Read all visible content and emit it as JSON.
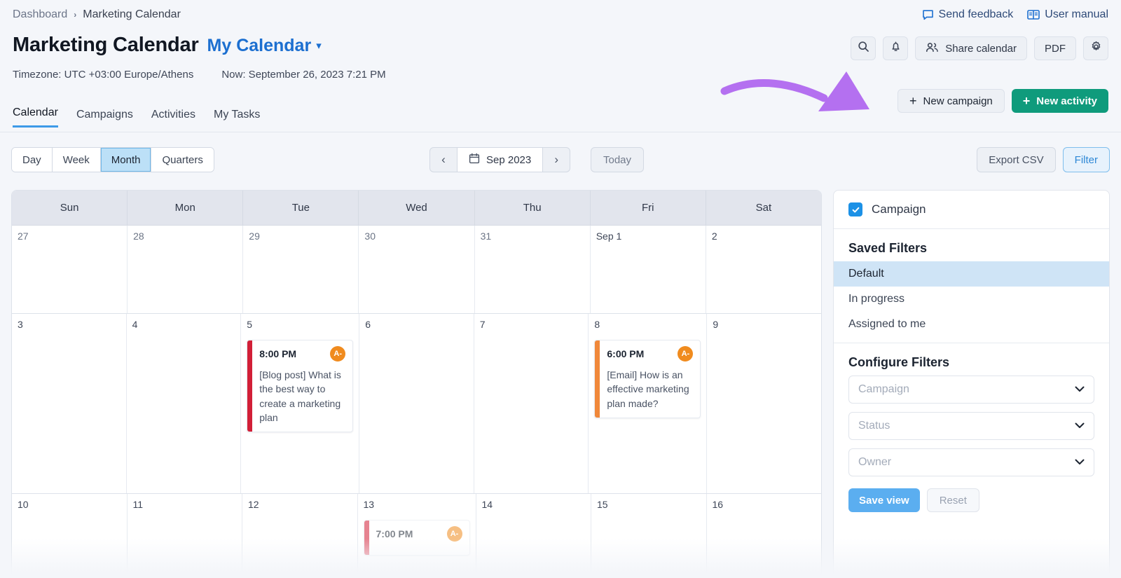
{
  "breadcrumb": {
    "root": "Dashboard",
    "separator": "›",
    "current": "Marketing Calendar"
  },
  "toplinks": {
    "feedback": "Send feedback",
    "manual": "User manual"
  },
  "header": {
    "title": "Marketing Calendar",
    "calendar_name": "My Calendar",
    "timezone": "Timezone: UTC +03:00 Europe/Athens",
    "now": "Now: September 26, 2023 7:21 PM",
    "share_calendar": "Share calendar",
    "pdf": "PDF"
  },
  "tabs": [
    {
      "label": "Calendar",
      "active": true
    },
    {
      "label": "Campaigns",
      "active": false
    },
    {
      "label": "Activities",
      "active": false
    },
    {
      "label": "My Tasks",
      "active": false
    }
  ],
  "actions": {
    "new_campaign": "New campaign",
    "new_activity": "New activity",
    "plus": "+"
  },
  "controls": {
    "views": [
      "Day",
      "Week",
      "Month",
      "Quarters"
    ],
    "active_view": "Month",
    "prev": "‹",
    "next": "›",
    "date_label": "Sep 2023",
    "today": "Today",
    "export": "Export CSV",
    "filter": "Filter"
  },
  "calendar": {
    "weekdays": [
      "Sun",
      "Mon",
      "Tue",
      "Wed",
      "Thu",
      "Fri",
      "Sat"
    ],
    "weeks": [
      {
        "days": [
          {
            "num": "27",
            "in_month": false
          },
          {
            "num": "28",
            "in_month": false
          },
          {
            "num": "29",
            "in_month": false
          },
          {
            "num": "30",
            "in_month": false
          },
          {
            "num": "31",
            "in_month": false
          },
          {
            "num": "Sep 1",
            "in_month": true
          },
          {
            "num": "2",
            "in_month": true
          }
        ]
      },
      {
        "days": [
          {
            "num": "3",
            "in_month": true
          },
          {
            "num": "4",
            "in_month": true
          },
          {
            "num": "5",
            "in_month": true,
            "event": {
              "time": "8:00 PM",
              "title": "[Blog post] What is the best way to create a marketing plan",
              "avatar": "A-",
              "bar_color": "#D21F37"
            }
          },
          {
            "num": "6",
            "in_month": true
          },
          {
            "num": "7",
            "in_month": true
          },
          {
            "num": "8",
            "in_month": true,
            "event": {
              "time": "6:00 PM",
              "title": "[Email] How is an effective marketing plan made?",
              "avatar": "A-",
              "bar_color": "#F0883A"
            }
          },
          {
            "num": "9",
            "in_month": true
          }
        ]
      },
      {
        "days": [
          {
            "num": "10",
            "in_month": true
          },
          {
            "num": "11",
            "in_month": true
          },
          {
            "num": "12",
            "in_month": true
          },
          {
            "num": "13",
            "in_month": true,
            "event": {
              "time": "7:00 PM",
              "title": "",
              "avatar": "A-",
              "bar_color": "#D21F37",
              "faded": true
            }
          },
          {
            "num": "14",
            "in_month": true
          },
          {
            "num": "15",
            "in_month": true
          },
          {
            "num": "16",
            "in_month": true
          }
        ]
      }
    ]
  },
  "filters": {
    "campaign_checkbox": "Campaign",
    "campaign_checked": true,
    "saved_filters_heading": "Saved Filters",
    "saved_filters": [
      {
        "label": "Default",
        "selected": true
      },
      {
        "label": "In progress",
        "selected": false
      },
      {
        "label": "Assigned to me",
        "selected": false
      }
    ],
    "configure_heading": "Configure Filters",
    "selects": [
      {
        "placeholder": "Campaign"
      },
      {
        "placeholder": "Status"
      },
      {
        "placeholder": "Owner"
      }
    ],
    "save_view": "Save view",
    "reset": "Reset"
  },
  "colors": {
    "accent_blue": "#1C91E6",
    "green": "#0F9B7C",
    "annotation_purple": "#B470F0",
    "event_red": "#D21F37",
    "event_orange": "#F0883A",
    "avatar_orange": "#F08B1E"
  }
}
